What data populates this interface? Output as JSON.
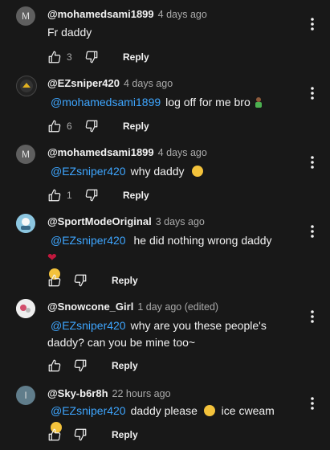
{
  "comments": [
    {
      "avatar": "M",
      "handle": "@mohamedsami1899",
      "time": "4 days ago",
      "mention": "",
      "text": "Fr daddy",
      "likes": "3",
      "reply": "Reply"
    },
    {
      "avatar": "",
      "handle": "@EZsniper420",
      "time": "4 days ago",
      "mention": "@mohamedsami1899",
      "text": "log off for me bro",
      "likes": "6",
      "reply": "Reply"
    },
    {
      "avatar": "M",
      "handle": "@mohamedsami1899",
      "time": "4 days ago",
      "mention": "@EZsniper420",
      "text": "why daddy",
      "likes": "1",
      "reply": "Reply"
    },
    {
      "avatar": "",
      "handle": "@SportModeOriginal",
      "time": "3 days ago",
      "mention": "@EZsniper420",
      "text": "he did nothing wrong daddy",
      "likes": "",
      "reply": "Reply"
    },
    {
      "avatar": "",
      "handle": "@Snowcone_Girl",
      "time": "1 day ago (edited)",
      "mention": "@EZsniper420",
      "text": "why are you these people's daddy? can you be mine too~",
      "likes": "",
      "reply": "Reply"
    },
    {
      "avatar": "I",
      "handle": "@Sky-b6r8h",
      "time": "22 hours ago",
      "mention": "@EZsniper420",
      "text": "daddy please",
      "text2": "ice cweam",
      "likes": "",
      "reply": "Reply"
    }
  ],
  "icons": {
    "like": "thumbs-up-icon",
    "dislike": "thumbs-down-icon",
    "more": "more-vert-icon"
  },
  "colors": {
    "background": "#181818",
    "mention": "#3ea6ff",
    "muted": "#aaaaaa"
  }
}
